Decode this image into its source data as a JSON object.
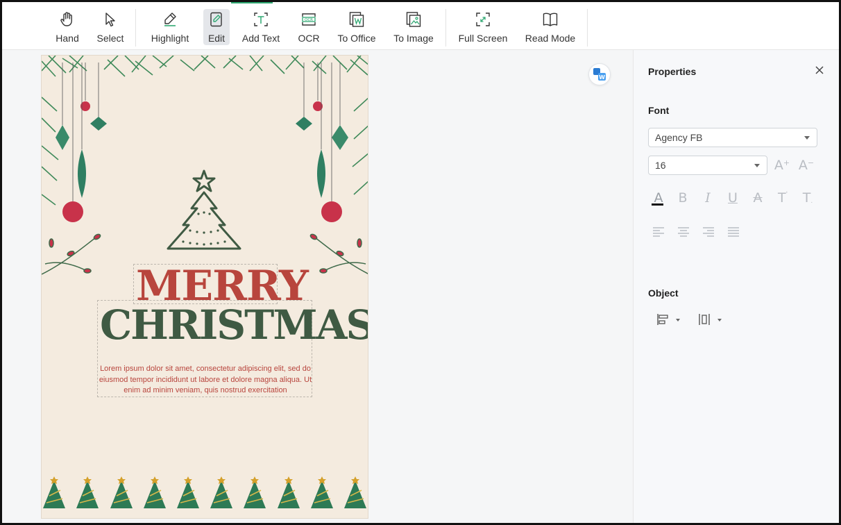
{
  "toolbar": {
    "hand": "Hand",
    "select": "Select",
    "highlight": "Highlight",
    "edit": "Edit",
    "add_text": "Add Text",
    "ocr": "OCR",
    "to_office": "To Office",
    "to_image": "To Image",
    "full_screen": "Full Screen",
    "read_mode": "Read Mode",
    "active_tool": "Edit",
    "accent_color": "#2fa872"
  },
  "document": {
    "title_line1": "MERRY",
    "title_line2": "CHRISTMAS",
    "body_text": "Lorem ipsum dolor sit amet, consectetur adipiscing elit, sed do eiusmod tempor incididunt ut labore et dolore magna aliqua. Ut enim ad minim veniam, quis nostrud exercitation",
    "colors": {
      "red": "#b8453d",
      "green": "#3f5a43",
      "background": "#f4ebdf"
    }
  },
  "properties": {
    "title": "Properties",
    "font_section": "Font",
    "font_family": "Agency FB",
    "font_size": "16",
    "object_section": "Object",
    "icons": [
      "font-color-icon",
      "bold-icon",
      "italic-icon",
      "underline-icon",
      "strikethrough-icon",
      "superscript-icon",
      "subscript-icon",
      "align-left-icon",
      "align-center-icon",
      "align-right-icon",
      "justify-icon",
      "object-align-icon",
      "object-distribute-icon"
    ]
  }
}
